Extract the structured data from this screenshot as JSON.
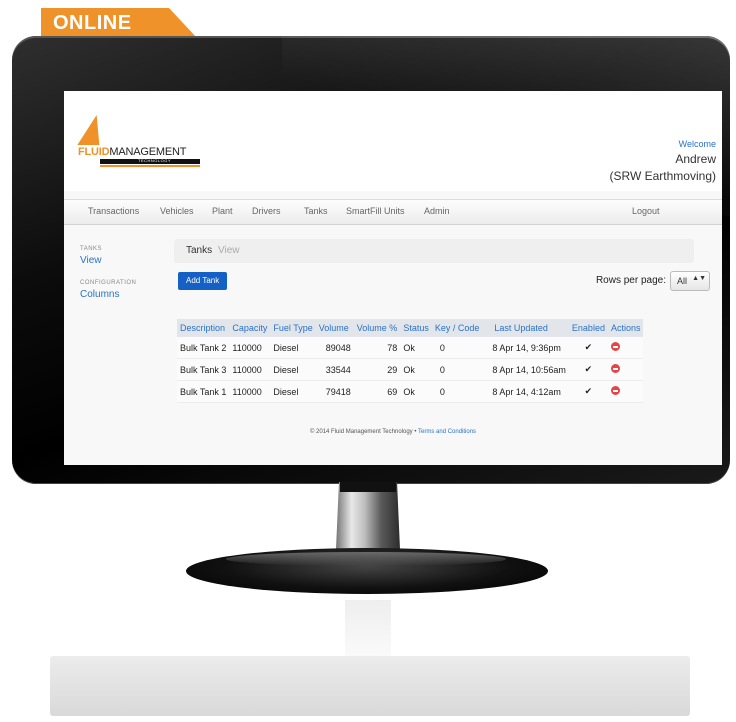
{
  "badge": {
    "label": "ONLINE",
    "color": "#f0922a"
  },
  "logo": {
    "part1": "FLUID",
    "part2": "MANAGEMENT",
    "part3": "TECHNOLOGY"
  },
  "user": {
    "greeting": "Welcome",
    "name": "Andrew",
    "company": "(SRW Earthmoving)"
  },
  "nav": {
    "items": [
      "Transactions",
      "Vehicles",
      "Plant",
      "Drivers",
      "Tanks",
      "SmartFill Units",
      "Admin"
    ],
    "logout": "Logout"
  },
  "sidebar": {
    "tanks_heading": "TANKS",
    "view_link": "View",
    "config_heading": "CONFIGURATION",
    "columns_link": "Columns"
  },
  "tabs": {
    "active": "Tanks",
    "inactive": "View"
  },
  "add_button": "Add Tank",
  "rows_per_page": {
    "label": "Rows per page:",
    "value": "All",
    "arrow": "▲▼"
  },
  "table": {
    "headers": [
      "Description",
      "Capacity",
      "Fuel Type",
      "Volume",
      "Volume %",
      "Status",
      "Key / Code",
      "Last Updated",
      "Enabled",
      "Actions"
    ],
    "rows": [
      {
        "description": "Bulk Tank 2",
        "capacity": "110000",
        "fuel": "Diesel",
        "volume": "89048",
        "pct": "78",
        "status": "Ok",
        "key": "0",
        "updated": "8 Apr 14, 9:36pm",
        "enabled": "✔"
      },
      {
        "description": "Bulk Tank 3",
        "capacity": "110000",
        "fuel": "Diesel",
        "volume": "33544",
        "pct": "29",
        "status": "Ok",
        "key": "0",
        "updated": "8 Apr 14, 10:56am",
        "enabled": "✔"
      },
      {
        "description": "Bulk Tank 1",
        "capacity": "110000",
        "fuel": "Diesel",
        "volume": "79418",
        "pct": "69",
        "status": "Ok",
        "key": "0",
        "updated": "8 Apr 14, 4:12am",
        "enabled": "✔"
      }
    ]
  },
  "footer": {
    "copyright": "© 2014 Fluid Management Technology",
    "separator": "•",
    "terms": "Terms and Conditions"
  },
  "colors": {
    "accent": "#f0922a",
    "link": "#2a72c8",
    "button": "#1560c4",
    "delete": "#e54545"
  }
}
